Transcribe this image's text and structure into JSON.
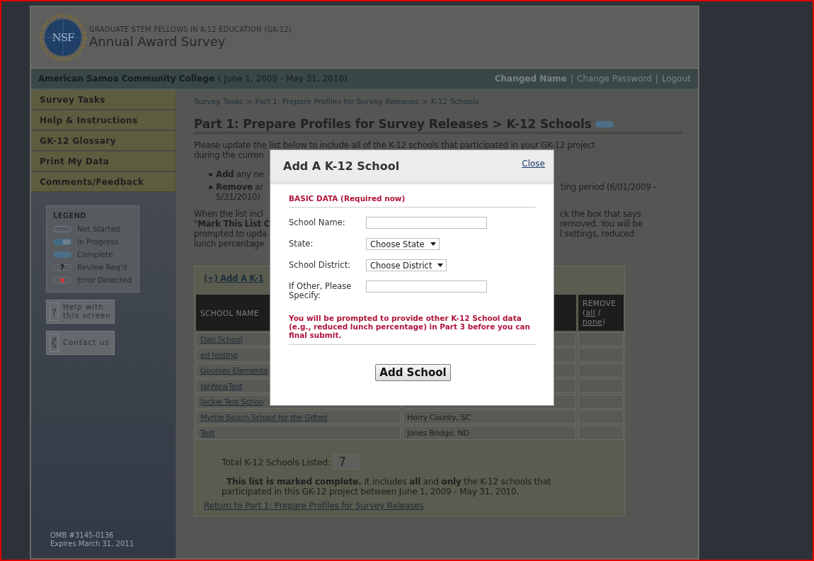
{
  "header": {
    "logo_text": "NSF",
    "subtitle": "GRADUATE STEM FELLOWS IN K-12 EDUCATION (GK-12)",
    "title": "Annual Award Survey"
  },
  "account_bar": {
    "institution": "American Samoa Community College",
    "period": "( June 1, 2009 - May 31, 2010)",
    "separator": "|",
    "links": [
      {
        "label": "Changed Name",
        "kind": "user"
      },
      {
        "label": "Change Password",
        "kind": "plain"
      },
      {
        "label": "Logout",
        "kind": "plain"
      }
    ]
  },
  "sidebar": {
    "items": [
      "Survey Tasks",
      "Help & Instructions",
      "GK-12 Glossary",
      "Print My Data",
      "Comments/Feedback"
    ]
  },
  "legend": {
    "title": "LEGEND",
    "items": [
      {
        "label": "Not Started",
        "kind": "not_started"
      },
      {
        "label": "In Progress",
        "kind": "in_progress"
      },
      {
        "label": "Complete",
        "kind": "complete"
      },
      {
        "label": "Review Req'd",
        "kind": "review",
        "symbol": "?"
      },
      {
        "label": "Error Detected",
        "kind": "error",
        "symbol": "x"
      }
    ]
  },
  "help_buttons": [
    {
      "label": "Help with this screen",
      "kind": "help",
      "symbol": "?"
    },
    {
      "label": "Contact us",
      "kind": "phone"
    }
  ],
  "footer": {
    "omb": "OMB #3145-0136",
    "expires": "Expires March 31, 2011"
  },
  "breadcrumb": {
    "separator": ">",
    "items": [
      "Survey Tasks",
      "Part 1: Prepare Profiles for Survey Releases",
      "K-12 Schools"
    ]
  },
  "heading": {
    "text": "Part 1: Prepare Profiles for Survey Releases > K-12 Schools",
    "kind": "complete"
  },
  "intro": {
    "line_1": "Please update the list below to include all of the K-12 schools that participated in your GK-12 project",
    "line_2_start": "during the curren"
  },
  "bullets": [
    {
      "start": "**Add** any ne"
    },
    {
      "start": "**Remove** ar",
      "end": "ting period (6/01/2009 -",
      "line_2_start": "5/31/2010)"
    }
  ],
  "completion_paragraph": [
    {
      "start": "When the list incl",
      "end": "ck the box that says"
    },
    {
      "start": "\"**Mark This List C**",
      "end": "removed. You will be"
    },
    {
      "start": "prompted to upda",
      "end": "l settings, reduced"
    },
    {
      "start": "lunch percentage"
    }
  ],
  "table": {
    "add_link": "(+) Add A K-1",
    "school_header": "SCHOOL NAME",
    "remove_header": {
      "label": "REMOVE",
      "open": "(",
      "links": [
        "all",
        "none"
      ],
      "separator": "/",
      "close": ")"
    },
    "rows": [
      {
        "school": "Dan School"
      },
      {
        "school": "ed testing"
      },
      {
        "school": "Goonies Elementa"
      },
      {
        "school": "IanNewTest"
      },
      {
        "school": "Jackie Test Schoo"
      },
      {
        "school": "Myrtle Beach School for the Gifted",
        "district": "Horry County, SC"
      },
      {
        "school": "Test",
        "district": "Jones Bridge, ND"
      }
    ]
  },
  "summary": {
    "total_label": "Total K-12 Schools Listed:",
    "total_value": "7",
    "statement": "**This list is marked complete.** It includes **all** and **only** the K-12 schools that participated in this GK-12 project between June 1, 2009 - May 31, 2010.",
    "return_link": "Return to Part 1: Prepare Profiles for Survey Releases"
  },
  "modal": {
    "title": "Add A K-12 School",
    "close": "Close",
    "section": "BASIC DATA (Required now)",
    "fields": [
      {
        "label": "School Name:",
        "kind": "text"
      },
      {
        "label": "State:",
        "kind": "select",
        "value": "Choose State"
      },
      {
        "label": "School District:",
        "kind": "select",
        "value": "Choose District"
      },
      {
        "label": "If Other, Please Specify:",
        "kind": "text"
      }
    ],
    "note": "You will be prompted to provide other K-12 School data (e.g., reduced lunch percentage) in Part 3 before you can final submit.",
    "button": "Add School"
  }
}
